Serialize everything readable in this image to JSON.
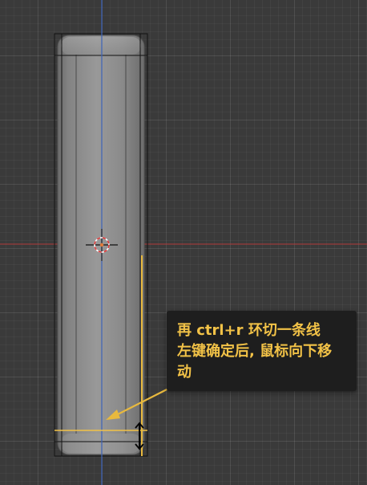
{
  "viewport": {
    "background": "#3a3a3a",
    "x_axis_color": "#b23a3a",
    "y_axis_color": "#3c63b8"
  },
  "scene": {
    "selected_edge_color": "#f2c247",
    "guide_color": "#e8b93e",
    "mesh_edge_color": "#111111",
    "origin_color": "#e07a3a"
  },
  "tooltip": {
    "lines": [
      "再 ctrl+r 环切一条线",
      "左键确定后, 鼠标向下移",
      "动"
    ],
    "color": "#f2c247",
    "background": "#1e1e1e"
  },
  "icons": {
    "cursor": "move-vertical-icon",
    "origin": "origin-icon",
    "arrow": "arrow-icon"
  }
}
